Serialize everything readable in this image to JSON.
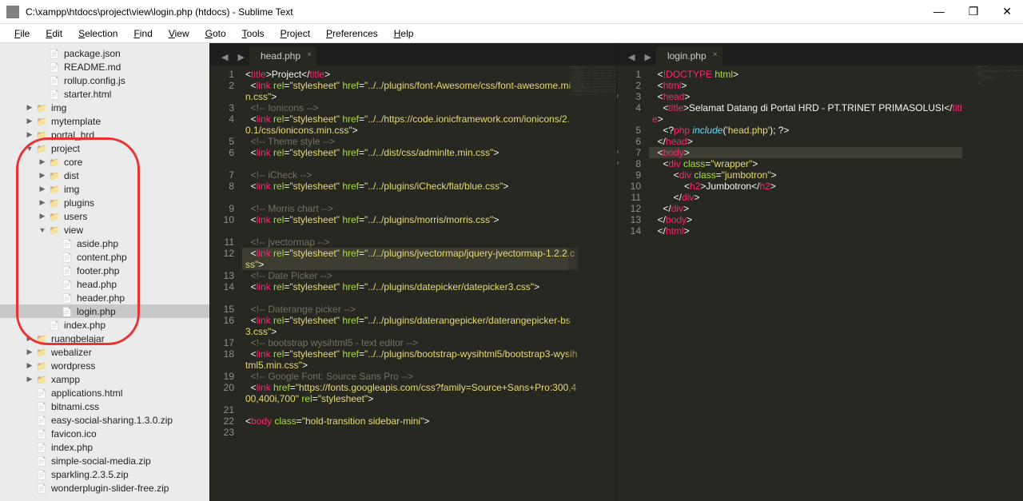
{
  "window": {
    "title": "C:\\xampp\\htdocs\\project\\view\\login.php (htdocs) - Sublime Text"
  },
  "menu": [
    "File",
    "Edit",
    "Selection",
    "Find",
    "View",
    "Goto",
    "Tools",
    "Project",
    "Preferences",
    "Help"
  ],
  "sidebar": {
    "items": [
      {
        "depth": 3,
        "type": "file",
        "label": "package.json",
        "arrow": ""
      },
      {
        "depth": 3,
        "type": "file",
        "label": "README.md",
        "arrow": ""
      },
      {
        "depth": 3,
        "type": "file",
        "label": "rollup.config.js",
        "arrow": ""
      },
      {
        "depth": 3,
        "type": "file",
        "label": "starter.html",
        "arrow": ""
      },
      {
        "depth": 2,
        "type": "folder",
        "label": "img",
        "arrow": "closed"
      },
      {
        "depth": 2,
        "type": "folder",
        "label": "mytemplate",
        "arrow": "closed"
      },
      {
        "depth": 2,
        "type": "folder",
        "label": "portal_hrd",
        "arrow": "closed"
      },
      {
        "depth": 2,
        "type": "folder",
        "label": "project",
        "arrow": "open"
      },
      {
        "depth": 3,
        "type": "folder",
        "label": "core",
        "arrow": "closed"
      },
      {
        "depth": 3,
        "type": "folder",
        "label": "dist",
        "arrow": "closed"
      },
      {
        "depth": 3,
        "type": "folder",
        "label": "img",
        "arrow": "closed"
      },
      {
        "depth": 3,
        "type": "folder",
        "label": "plugins",
        "arrow": "closed"
      },
      {
        "depth": 3,
        "type": "folder",
        "label": "users",
        "arrow": "closed"
      },
      {
        "depth": 3,
        "type": "folder",
        "label": "view",
        "arrow": "open"
      },
      {
        "depth": 4,
        "type": "file",
        "label": "aside.php",
        "arrow": ""
      },
      {
        "depth": 4,
        "type": "file",
        "label": "content.php",
        "arrow": ""
      },
      {
        "depth": 4,
        "type": "file",
        "label": "footer.php",
        "arrow": ""
      },
      {
        "depth": 4,
        "type": "file",
        "label": "head.php",
        "arrow": ""
      },
      {
        "depth": 4,
        "type": "file",
        "label": "header.php",
        "arrow": ""
      },
      {
        "depth": 4,
        "type": "file",
        "label": "login.php",
        "arrow": "",
        "selected": true
      },
      {
        "depth": 3,
        "type": "file",
        "label": "index.php",
        "arrow": ""
      },
      {
        "depth": 2,
        "type": "folder",
        "label": "ruangbelajar",
        "arrow": "closed"
      },
      {
        "depth": 2,
        "type": "folder",
        "label": "webalizer",
        "arrow": "closed"
      },
      {
        "depth": 2,
        "type": "folder",
        "label": "wordpress",
        "arrow": "closed"
      },
      {
        "depth": 2,
        "type": "folder",
        "label": "xampp",
        "arrow": "closed"
      },
      {
        "depth": 2,
        "type": "file",
        "label": "applications.html",
        "arrow": ""
      },
      {
        "depth": 2,
        "type": "file",
        "label": "bitnami.css",
        "arrow": ""
      },
      {
        "depth": 2,
        "type": "file",
        "label": "easy-social-sharing.1.3.0.zip",
        "arrow": ""
      },
      {
        "depth": 2,
        "type": "file",
        "label": "favicon.ico",
        "arrow": ""
      },
      {
        "depth": 2,
        "type": "file",
        "label": "index.php",
        "arrow": ""
      },
      {
        "depth": 2,
        "type": "file",
        "label": "simple-social-media.zip",
        "arrow": ""
      },
      {
        "depth": 2,
        "type": "file",
        "label": "sparkling.2.3.5.zip",
        "arrow": ""
      },
      {
        "depth": 2,
        "type": "file",
        "label": "wonderplugin-slider-free.zip",
        "arrow": ""
      }
    ]
  },
  "editor1": {
    "tab": "head.php",
    "lines": [
      {
        "n": 1,
        "html": "<span class='txt'>&lt;</span><span class='tag'>title</span><span class='txt'>&gt;Project&lt;/</span><span class='tag'>title</span><span class='txt'>&gt;</span>"
      },
      {
        "n": 2,
        "html": "  <span class='txt'>&lt;</span><span class='tag'>link</span> <span class='attr'>rel</span><span class='txt'>=</span><span class='str'>\"stylesheet\"</span> <span class='attr'>href</span><span class='txt'>=</span><span class='str'>\"../../plugins/font-Awesome/css/font-awesome.min.css\"</span><span class='txt'>&gt;</span>"
      },
      {
        "n": 3,
        "html": "  <span class='com'>&lt;!-- Ionicons --&gt;</span>"
      },
      {
        "n": 4,
        "html": "  <span class='txt'>&lt;</span><span class='tag'>link</span> <span class='attr'>rel</span><span class='txt'>=</span><span class='str'>\"stylesheet\"</span> <span class='attr'>href</span><span class='txt'>=</span><span class='str'>\"../../https://code.ionicframework.com/ionicons/2.0.1/css/ionicons.min.css\"</span><span class='txt'>&gt;</span>"
      },
      {
        "n": 5,
        "html": "  <span class='com'>&lt;!-- Theme style --&gt;</span>"
      },
      {
        "n": 6,
        "html": "  <span class='txt'>&lt;</span><span class='tag'>link</span> <span class='attr'>rel</span><span class='txt'>=</span><span class='str'>\"stylesheet\"</span> <span class='attr'>href</span><span class='txt'>=</span><span class='str'>\"../../dist/css/adminlte.min.css\"</span><span class='txt'>&gt;</span>"
      },
      {
        "n": 7,
        "html": "  <span class='com'>&lt;!-- iCheck --&gt;</span>"
      },
      {
        "n": 8,
        "html": "  <span class='txt'>&lt;</span><span class='tag'>link</span> <span class='attr'>rel</span><span class='txt'>=</span><span class='str'>\"stylesheet\"</span> <span class='attr'>href</span><span class='txt'>=</span><span class='str'>\"../../plugins/iCheck/flat/blue.css\"</span><span class='txt'>&gt;</span>"
      },
      {
        "n": 9,
        "html": "  <span class='com'>&lt;!-- Morris chart --&gt;</span>"
      },
      {
        "n": 10,
        "html": "  <span class='txt'>&lt;</span><span class='tag'>link</span> <span class='attr'>rel</span><span class='txt'>=</span><span class='str'>\"stylesheet\"</span> <span class='attr'>href</span><span class='txt'>=</span><span class='str'>\"../../plugins/morris/morris.css\"</span><span class='txt'>&gt;</span>"
      },
      {
        "n": 11,
        "html": "  <span class='com'>&lt;!-- jvectormap --&gt;</span>"
      },
      {
        "n": 12,
        "hl": true,
        "html": "  <span class='txt'>&lt;</span><span class='tag'>link</span> <span class='attr'>rel</span><span class='txt'>=</span><span class='str'>\"stylesheet\"</span> <span class='attr'>href</span><span class='txt'>=</span><span class='str'>\"../../plugins/jvectormap/jquery-jvectormap-1.2.2.css\"</span><span class='txt'>&gt;</span>"
      },
      {
        "n": 13,
        "html": "  <span class='com'>&lt;!-- Date Picker --&gt;</span>"
      },
      {
        "n": 14,
        "html": "  <span class='txt'>&lt;</span><span class='tag'>link</span> <span class='attr'>rel</span><span class='txt'>=</span><span class='str'>\"stylesheet\"</span> <span class='attr'>href</span><span class='txt'>=</span><span class='str'>\"../../plugins/datepicker/datepicker3.css\"</span><span class='txt'>&gt;</span>"
      },
      {
        "n": 15,
        "html": "  <span class='com'>&lt;!-- Daterange picker --&gt;</span>"
      },
      {
        "n": 16,
        "html": "  <span class='txt'>&lt;</span><span class='tag'>link</span> <span class='attr'>rel</span><span class='txt'>=</span><span class='str'>\"stylesheet\"</span> <span class='attr'>href</span><span class='txt'>=</span><span class='str'>\"../../plugins/daterangepicker/daterangepicker-bs3.css\"</span><span class='txt'>&gt;</span>"
      },
      {
        "n": 17,
        "html": "  <span class='com'>&lt;!-- bootstrap wysihtml5 - text editor --&gt;</span>"
      },
      {
        "n": 18,
        "html": "  <span class='txt'>&lt;</span><span class='tag'>link</span> <span class='attr'>rel</span><span class='txt'>=</span><span class='str'>\"stylesheet\"</span> <span class='attr'>href</span><span class='txt'>=</span><span class='str'>\"../../plugins/bootstrap-wysihtml5/bootstrap3-wysihtml5.min.css\"</span><span class='txt'>&gt;</span>"
      },
      {
        "n": 19,
        "html": "  <span class='com'>&lt;!-- Google Font: Source Sans Pro --&gt;</span>"
      },
      {
        "n": 20,
        "html": "  <span class='txt'>&lt;</span><span class='tag'>link</span> <span class='attr'>href</span><span class='txt'>=</span><span class='str'>\"https://fonts.googleapis.com/css?family=Source+Sans+Pro:300,400,400i,700\"</span> <span class='attr'>rel</span><span class='txt'>=</span><span class='str'>\"stylesheet\"</span><span class='txt'>&gt;</span>"
      },
      {
        "n": 21,
        "html": ""
      },
      {
        "n": 22,
        "html": "<span class='txt'>&lt;</span><span class='tag'>body</span> <span class='attr'>class</span><span class='txt'>=</span><span class='str'>\"hold-transition sidebar-mini\"</span><span class='txt'>&gt;</span>"
      },
      {
        "n": 23,
        "html": ""
      }
    ]
  },
  "editor2": {
    "tab": "login.php",
    "lines": [
      {
        "n": 1,
        "html": "  <span class='txt'>&lt;</span><span class='tag'>!DOCTYPE</span> <span class='attr'>html</span><span class='txt'>&gt;</span>"
      },
      {
        "n": 2,
        "html": "  <span class='txt'>&lt;</span><span class='tag'>html</span><span class='txt'>&gt;</span>"
      },
      {
        "n": 3,
        "fold": "▼",
        "html": "  <span class='txt'>&lt;</span><span class='tag'>head</span><span class='txt'>&gt;</span>"
      },
      {
        "n": 4,
        "html": "    <span class='txt'>&lt;</span><span class='tag'>title</span><span class='txt'>&gt;Selamat Datang di Portal HRD - PT.TRINET PRIMASOLUSI&lt;/</span><span class='tag'>title</span><span class='txt'>&gt;</span>"
      },
      {
        "n": 5,
        "html": "    <span class='txt'>&lt;?</span><span class='tag'>php</span> <span class='kw'>include</span><span class='txt'>(</span><span class='str'>'head.php'</span><span class='txt'>); ?&gt;</span>"
      },
      {
        "n": 6,
        "html": "  <span class='txt'>&lt;/</span><span class='tag'>head</span><span class='txt'>&gt;</span>"
      },
      {
        "n": 7,
        "hl": true,
        "fold": "▼",
        "html": "  <span class='txt'>&lt;</span><span class='tag'>body</span><span class='txt'>&gt;</span>"
      },
      {
        "n": 8,
        "fold": "▼",
        "html": "    <span class='txt'>&lt;</span><span class='tag'>div</span> <span class='attr'>class</span><span class='txt'>=</span><span class='str'>\"wrapper\"</span><span class='txt'>&gt;</span>"
      },
      {
        "n": 9,
        "html": "        <span class='txt'>&lt;</span><span class='tag'>div</span> <span class='attr'>class</span><span class='txt'>=</span><span class='str'>\"jumbotron\"</span><span class='txt'>&gt;</span>"
      },
      {
        "n": 10,
        "html": "            <span class='txt'>&lt;</span><span class='tag'>h2</span><span class='txt'>&gt;Jumbotron&lt;/</span><span class='tag'>h2</span><span class='txt'>&gt;</span>"
      },
      {
        "n": 11,
        "html": "        <span class='txt'>&lt;/</span><span class='tag'>div</span><span class='txt'>&gt;</span>"
      },
      {
        "n": 12,
        "html": "    <span class='txt'>&lt;/</span><span class='tag'>div</span><span class='txt'>&gt;</span>"
      },
      {
        "n": 13,
        "html": "  <span class='txt'>&lt;/</span><span class='tag'>body</span><span class='txt'>&gt;</span>"
      },
      {
        "n": 14,
        "html": "  <span class='txt'>&lt;/</span><span class='tag'>html</span><span class='txt'>&gt;</span>"
      }
    ]
  }
}
